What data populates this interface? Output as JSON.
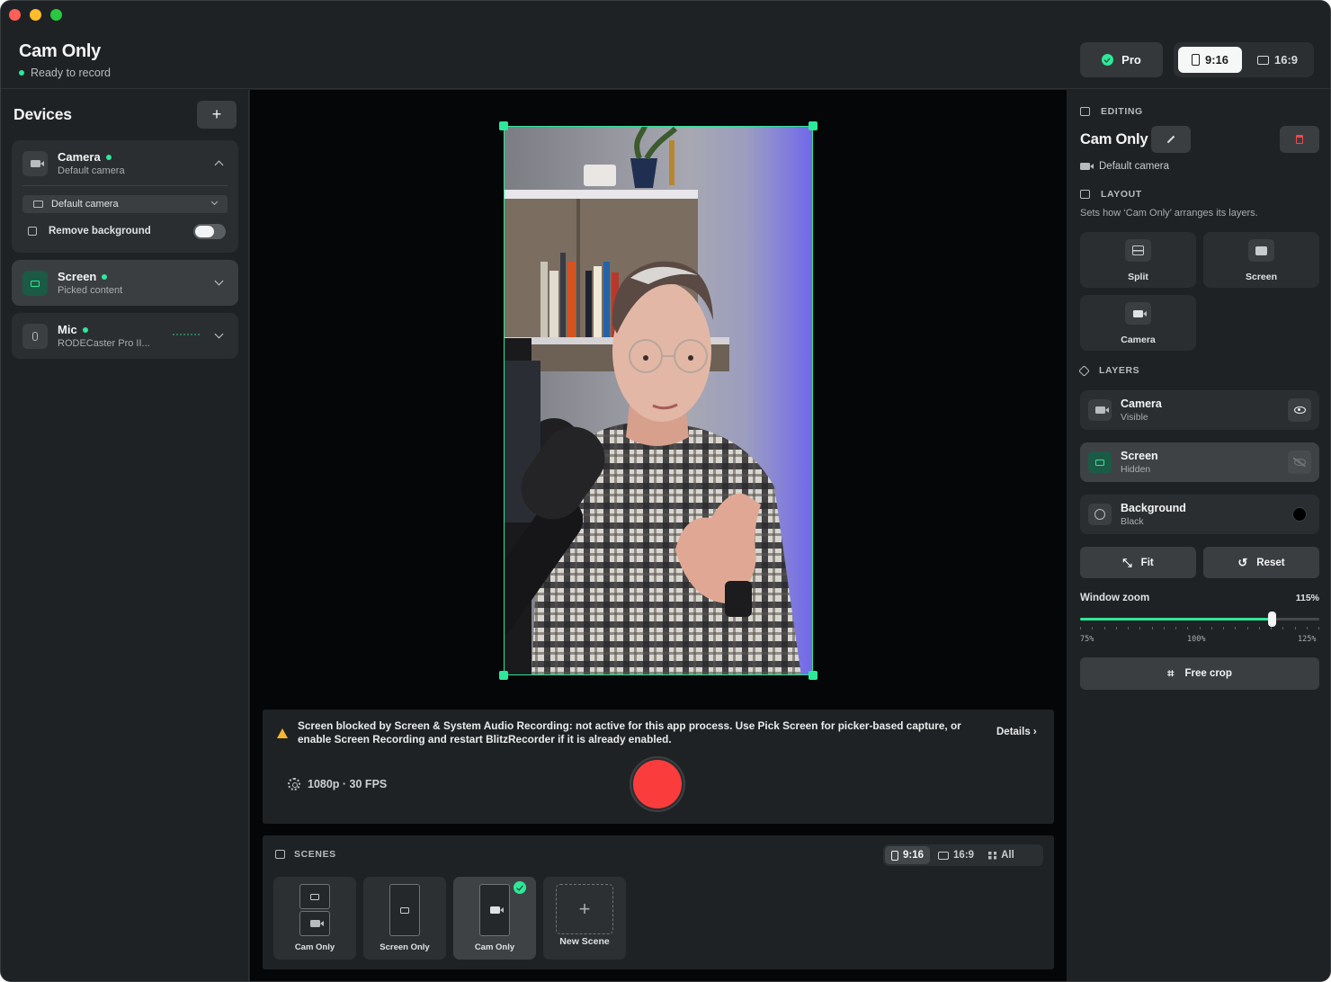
{
  "window": {
    "title": "Cam Only",
    "status": "Ready to record"
  },
  "header": {
    "pro_label": "Pro",
    "ratio_options": [
      "9:16",
      "16:9"
    ],
    "ratio_selected": "9:16"
  },
  "devices": {
    "title": "Devices",
    "add_label": "+",
    "camera": {
      "name": "Camera",
      "sub": "Default camera",
      "select_value": "Default camera",
      "remove_bg_label": "Remove background",
      "remove_bg_enabled": false
    },
    "screen": {
      "name": "Screen",
      "sub": "Picked content"
    },
    "mic": {
      "name": "Mic",
      "sub": "RODECaster Pro II..."
    }
  },
  "alert": {
    "text": "Screen blocked by Screen & System Audio Recording: not active for this app process. Use Pick Screen for picker-based capture, or enable Screen Recording and restart BlitzRecorder if it is already enabled.",
    "details_label": "Details ›"
  },
  "recording": {
    "quality": "1080p · 30 FPS"
  },
  "scenes": {
    "title": "SCENES",
    "filters": [
      "9:16",
      "16:9",
      "All"
    ],
    "filter_selected": "9:16",
    "items": [
      {
        "label": "Cam Only",
        "active": false
      },
      {
        "label": "Screen Only",
        "active": false
      },
      {
        "label": "Cam Only",
        "active": true
      }
    ],
    "new_label": "New Scene",
    "new_glyph": "+"
  },
  "editing": {
    "section": "EDITING",
    "scene_name": "Cam Only",
    "camera_source": "Default camera",
    "layout_section": "LAYOUT",
    "layout_desc": "Sets how ‘Cam Only’ arranges its layers.",
    "layouts": [
      "Split",
      "Screen",
      "Camera"
    ],
    "layers_section": "LAYERS",
    "layers": [
      {
        "name": "Camera",
        "state": "Visible"
      },
      {
        "name": "Screen",
        "state": "Hidden"
      },
      {
        "name": "Background",
        "state": "Black"
      }
    ],
    "background_color": "#000000",
    "fit_label": "Fit",
    "reset_label": "Reset",
    "zoom_label": "Window zoom",
    "zoom_value": "115%",
    "zoom_current": 115,
    "zoom_min_label": "75%",
    "zoom_mid_label": "100%",
    "zoom_max_label": "125%",
    "crop_label": "Free crop"
  },
  "colors": {
    "accent": "#2ee89a",
    "record": "#fa3c3c",
    "warning": "#f5b731"
  }
}
